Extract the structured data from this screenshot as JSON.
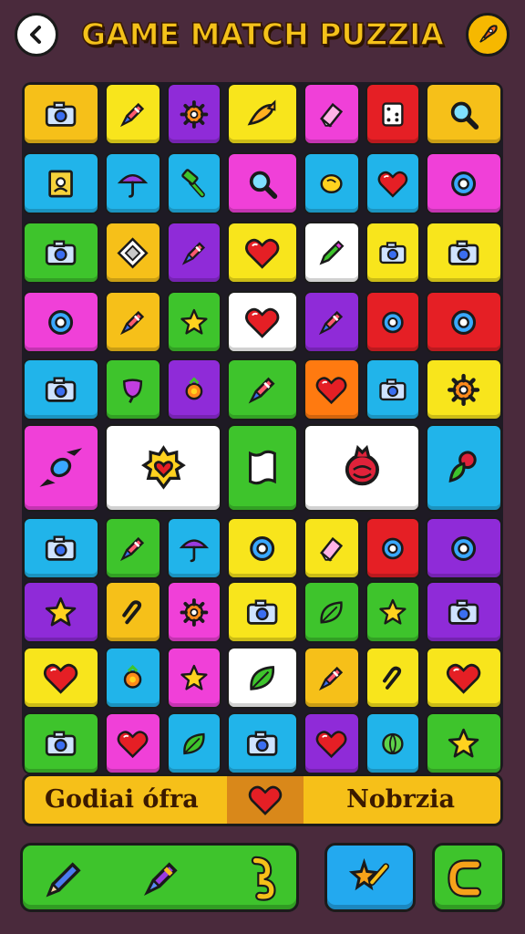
{
  "header": {
    "title": "GAME MATCH PUZZIA",
    "back_icon": "chevron-left-icon",
    "settings_icon": "rocket-icon"
  },
  "board": {
    "row_grid": [
      [
        {
          "color": "#f6c019",
          "icon": "camera"
        },
        {
          "color": "#f8e51c",
          "icon": "crayon"
        },
        {
          "color": "#8f2bd8",
          "icon": "gear"
        },
        {
          "color": "#f8e51c",
          "icon": "fish"
        },
        {
          "color": "#f040d8",
          "icon": "eraser"
        },
        {
          "color": "#e51f25",
          "icon": "dice"
        },
        {
          "color": "#f6c019",
          "icon": "magnifier"
        }
      ],
      [
        {
          "color": "#21b4ea",
          "icon": "photo"
        },
        {
          "color": "#21b4ea",
          "icon": "umbrella"
        },
        {
          "color": "#21b4ea",
          "icon": "hammer"
        },
        {
          "color": "#f040d8",
          "icon": "magnifier"
        },
        {
          "color": "#21b4ea",
          "icon": "lemon"
        },
        {
          "color": "#21b4ea",
          "icon": "heart"
        },
        {
          "color": "#f040d8",
          "icon": "ring"
        }
      ],
      [
        {
          "color": "#3ec42c",
          "icon": "camera"
        },
        {
          "color": "#f6c019",
          "icon": "frame"
        },
        {
          "color": "#8f2bd8",
          "icon": "crayon"
        },
        {
          "color": "#f8e51c",
          "icon": "heart"
        },
        {
          "color": "#ffffff",
          "icon": "marker"
        },
        {
          "color": "#f8e51c",
          "icon": "camera"
        },
        {
          "color": "#f8e51c",
          "icon": "camera"
        }
      ],
      [
        {
          "color": "#f040d8",
          "icon": "ring"
        },
        {
          "color": "#f6c019",
          "icon": "crayon"
        },
        {
          "color": "#3ec42c",
          "icon": "star"
        },
        {
          "color": "#ffffff",
          "icon": "heart"
        },
        {
          "color": "#8f2bd8",
          "icon": "crayon"
        },
        {
          "color": "#e51f25",
          "icon": "ring"
        },
        {
          "color": "#e51f25",
          "icon": "ring"
        }
      ],
      [
        {
          "color": "#21b4ea",
          "icon": "camera"
        },
        {
          "color": "#3ec42c",
          "icon": "tulip"
        },
        {
          "color": "#8f2bd8",
          "icon": "berry"
        },
        {
          "color": "#3ec42c",
          "icon": "crayon"
        },
        {
          "color": "#ff7a10",
          "icon": "heart"
        },
        {
          "color": "#21b4ea",
          "icon": "camera"
        },
        {
          "color": "#f8e51c",
          "icon": "gear"
        }
      ],
      [
        {
          "color": "#21b4ea",
          "icon": "camera"
        },
        {
          "color": "#3ec42c",
          "icon": "crayon"
        },
        {
          "color": "#21b4ea",
          "icon": "umbrella"
        },
        {
          "color": "#f8e51c",
          "icon": "ring"
        },
        {
          "color": "#f8e51c",
          "icon": "eraser"
        },
        {
          "color": "#e51f25",
          "icon": "ring"
        },
        {
          "color": "#8f2bd8",
          "icon": "ring"
        }
      ],
      [
        {
          "color": "#8f2bd8",
          "icon": "star"
        },
        {
          "color": "#f6c019",
          "icon": "clip"
        },
        {
          "color": "#f040d8",
          "icon": "gear"
        },
        {
          "color": "#f8e51c",
          "icon": "camera"
        },
        {
          "color": "#3ec42c",
          "icon": "leaf"
        },
        {
          "color": "#3ec42c",
          "icon": "star"
        },
        {
          "color": "#8f2bd8",
          "icon": "camera"
        }
      ],
      [
        {
          "color": "#f8e51c",
          "icon": "heart"
        },
        {
          "color": "#21b4ea",
          "icon": "berry"
        },
        {
          "color": "#f040d8",
          "icon": "star"
        },
        {
          "color": "#ffffff",
          "icon": "leaf"
        },
        {
          "color": "#f6c019",
          "icon": "crayon"
        },
        {
          "color": "#f8e51c",
          "icon": "clip"
        },
        {
          "color": "#f8e51c",
          "icon": "heart"
        }
      ],
      [
        {
          "color": "#3ec42c",
          "icon": "camera"
        },
        {
          "color": "#f040d8",
          "icon": "heart"
        },
        {
          "color": "#21b4ea",
          "icon": "leaf"
        },
        {
          "color": "#21b4ea",
          "icon": "camera"
        },
        {
          "color": "#8f2bd8",
          "icon": "heart"
        },
        {
          "color": "#21b4ea",
          "icon": "melon"
        },
        {
          "color": "#3ec42c",
          "icon": "star"
        }
      ]
    ],
    "big_row": [
      {
        "color": "#f040d8",
        "icon": "candy"
      },
      {
        "color": "#ffffff",
        "icon": "flower-heart"
      },
      {
        "color": "#3ec42c",
        "icon": "flag"
      },
      {
        "color": "#ffffff",
        "icon": "pomegranate"
      },
      {
        "color": "#21b4ea",
        "icon": "rose"
      }
    ]
  },
  "bottom_bar": {
    "left_text": "Godiai ófra",
    "right_text": "Nobrzia",
    "center_icon": "heart-icon"
  },
  "controls": {
    "green_icons": [
      "pencil-icon",
      "crayon-icon",
      "hook-icon"
    ],
    "blue_icon": "star-wand-icon",
    "green2_icon": "magnet-icon"
  },
  "colors": {
    "background": "#4a2a3c",
    "title": "#f4c21a",
    "accent_yellow": "#f6c019"
  }
}
